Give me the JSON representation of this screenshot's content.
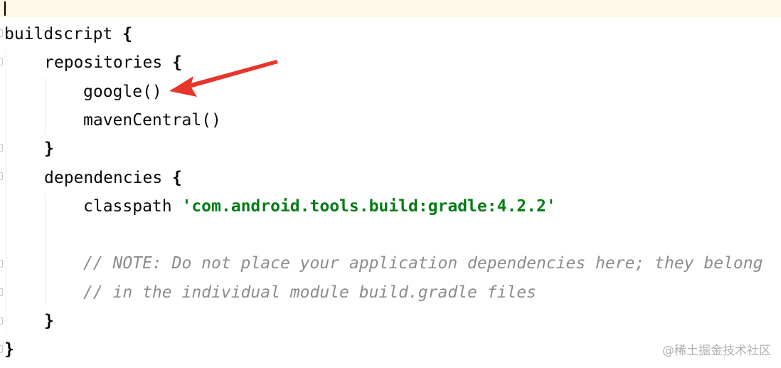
{
  "editor": {
    "lines": [
      {
        "indent": 0,
        "code": "buildscript",
        "suffix": " {",
        "type": "block"
      },
      {
        "indent": 1,
        "code": "repositories",
        "suffix": " {",
        "type": "block"
      },
      {
        "indent": 2,
        "code": "google()",
        "suffix": "",
        "type": "plain"
      },
      {
        "indent": 2,
        "code": "mavenCentral()",
        "suffix": "",
        "type": "plain"
      },
      {
        "indent": 1,
        "code": "",
        "suffix": "}",
        "type": "close"
      },
      {
        "indent": 1,
        "code": "dependencies",
        "suffix": " {",
        "type": "block"
      },
      {
        "indent": 2,
        "code": "classpath ",
        "suffix": "'com.android.tools.build:gradle:4.2.2'",
        "type": "string"
      },
      {
        "indent": 2,
        "code": "",
        "suffix": "",
        "type": "empty"
      },
      {
        "indent": 2,
        "code": "// NOTE: Do not place your application dependencies here; they belong",
        "suffix": "",
        "type": "comment"
      },
      {
        "indent": 2,
        "code": "// in the individual module build.gradle files",
        "suffix": "",
        "type": "comment"
      },
      {
        "indent": 1,
        "code": "",
        "suffix": "}",
        "type": "close"
      },
      {
        "indent": 0,
        "code": "",
        "suffix": "}",
        "type": "close"
      }
    ]
  },
  "watermark": {
    "text": "@稀土掘金技术社区"
  },
  "annotation": {
    "arrow_color": "#e8352b",
    "target": "google()"
  },
  "colors": {
    "current_line": "#fdf9e6",
    "string": "#067d17",
    "comment": "#8c8c8c",
    "text": "#080808"
  }
}
